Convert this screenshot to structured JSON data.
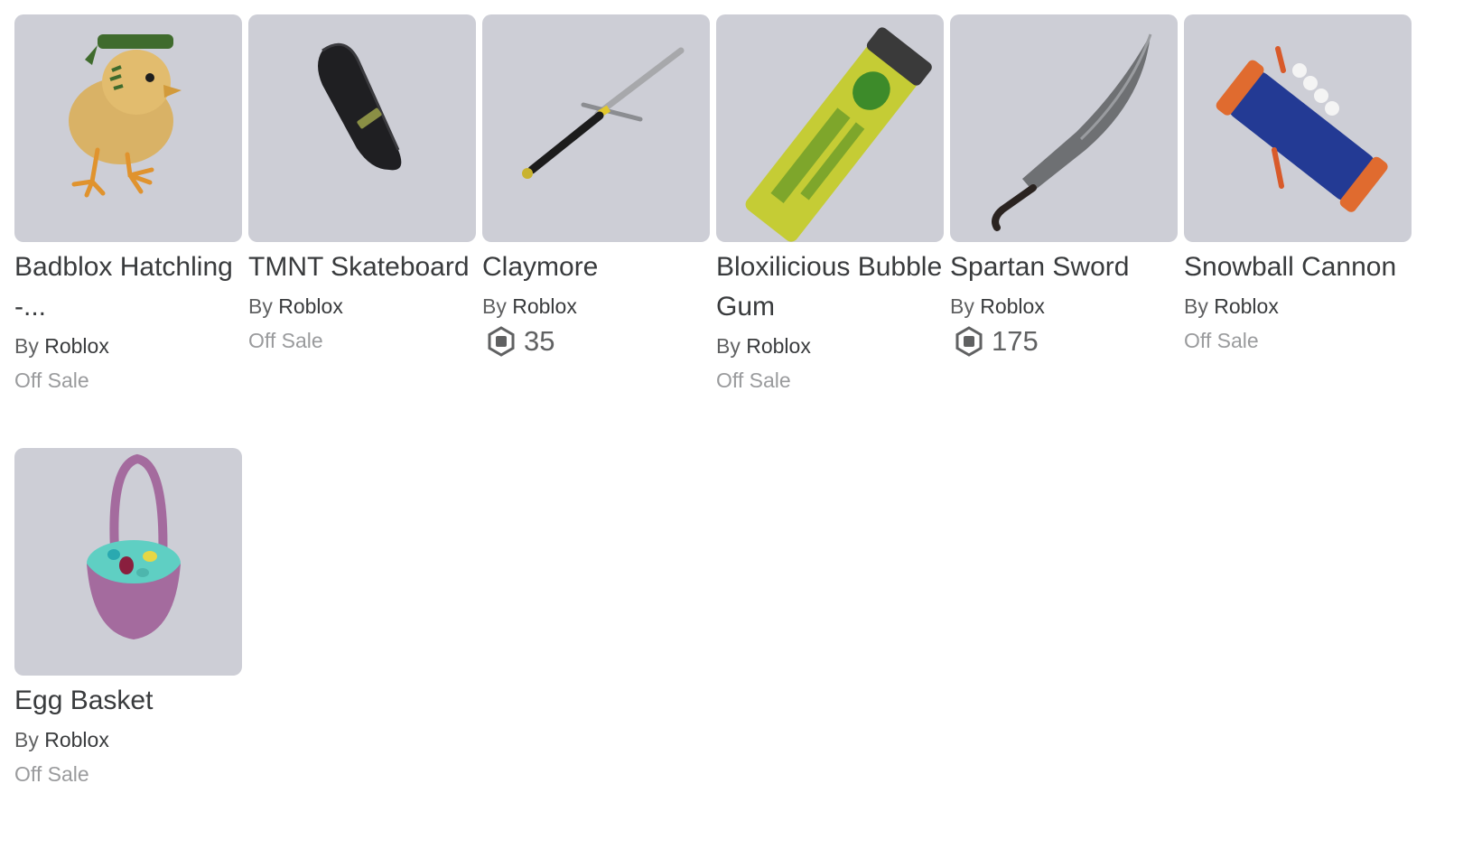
{
  "items": [
    {
      "name": "Badblox Hatchling -...",
      "by": "By",
      "creator": "Roblox",
      "status": "Off Sale",
      "icon": "chick-thumbnail"
    },
    {
      "name": "TMNT Skateboard",
      "by": "By",
      "creator": "Roblox",
      "status": "Off Sale",
      "icon": "skateboard-thumbnail"
    },
    {
      "name": "Claymore",
      "by": "By",
      "creator": "Roblox",
      "price": "35",
      "icon": "sword-thumbnail"
    },
    {
      "name": "Bloxilicious Bubble Gum",
      "by": "By",
      "creator": "Roblox",
      "status": "Off Sale",
      "icon": "bubble-gum-thumbnail"
    },
    {
      "name": "Spartan Sword",
      "by": "By",
      "creator": "Roblox",
      "price": "175",
      "icon": "machete-thumbnail"
    },
    {
      "name": "Snowball Cannon",
      "by": "By",
      "creator": "Roblox",
      "status": "Off Sale",
      "icon": "cannon-thumbnail"
    },
    {
      "name": "Egg Basket",
      "by": "By",
      "creator": "Roblox",
      "status": "Off Sale",
      "icon": "basket-thumbnail"
    }
  ],
  "colors": {
    "thumb_bg": "#cdced6",
    "text": "#393b3d",
    "muted": "#9a9b9d"
  }
}
